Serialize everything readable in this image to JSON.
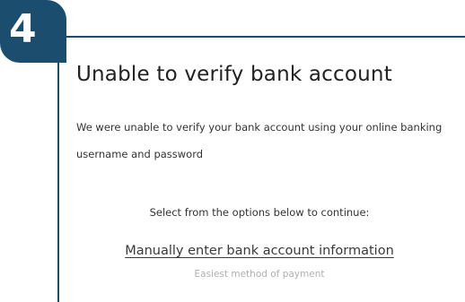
{
  "step": {
    "number": "4"
  },
  "dialog": {
    "title": "Unable to verify bank account",
    "message": "We were unable to verify your bank account using your online banking username and password",
    "instruction": "Select from the options below to continue:",
    "options": [
      {
        "label": "Manually enter bank account information",
        "description": "Easiest method of payment"
      }
    ]
  },
  "colors": {
    "accent": "#1b4d6e",
    "text": "#222222",
    "muted_text": "#b0b0b0"
  }
}
